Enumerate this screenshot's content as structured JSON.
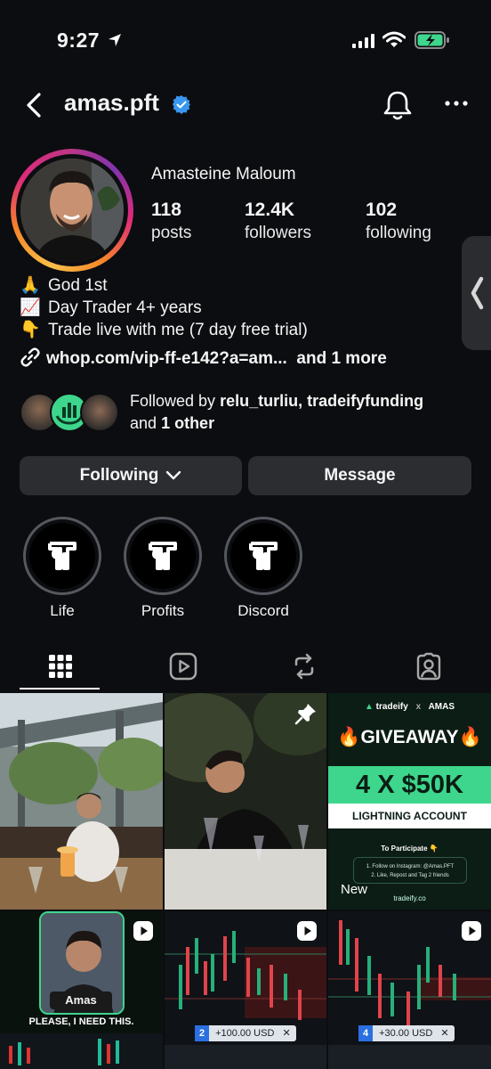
{
  "status_bar": {
    "time": "9:27"
  },
  "header": {
    "username": "amas.pft"
  },
  "profile": {
    "display_name": "Amasteine Maloum",
    "stats": [
      {
        "value": "118",
        "label": "posts"
      },
      {
        "value": "12.4K",
        "label": "followers"
      },
      {
        "value": "102",
        "label": "following"
      }
    ],
    "bio": [
      {
        "emoji": "🙏",
        "text": "God 1st"
      },
      {
        "emoji": "📈",
        "text": "Day Trader 4+ years"
      },
      {
        "emoji": "👇",
        "text": "Trade live with me (7 day free trial)"
      }
    ],
    "link": {
      "url": "whop.com/vip-ff-e142?a=am...",
      "more": "and 1 more"
    },
    "followed_by": {
      "prefix": "Followed by",
      "names": "relu_turliu, tradeifyfunding",
      "and": "and",
      "other": "1 other"
    }
  },
  "buttons": {
    "following": "Following",
    "message": "Message"
  },
  "highlights": [
    {
      "label": "Life"
    },
    {
      "label": "Profits"
    },
    {
      "label": "Discord"
    }
  ],
  "posts": {
    "giveaway": {
      "brand": "tradeify",
      "x": "x",
      "partner": "AMAS",
      "headline": "GIVEAWAY",
      "amount": "4 X $50K",
      "account": "LIGHTNING ACCOUNT",
      "participate": "To Participate",
      "step1": "1. Follow on Instagram: @Amas.PFT",
      "step2": "2. Like, Repost and Tag 2 friends",
      "site": "tradeify.co",
      "new_label": "New"
    },
    "reel1": {
      "name": "Amas",
      "caption": "PLEASE, I NEED THIS."
    },
    "reel2": {
      "badge_num": "2",
      "badge_text": "+100.00 USD"
    },
    "reel3": {
      "badge_num": "4",
      "badge_text": "+30.00 USD"
    }
  },
  "colors": {
    "background": "#0c0d10",
    "button": "#2b2d31",
    "verified": "#3897f0",
    "green": "#3dd68c"
  }
}
